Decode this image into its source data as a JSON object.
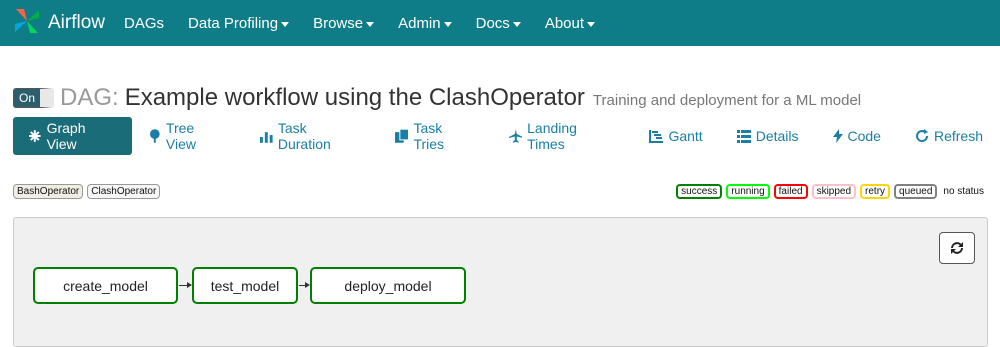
{
  "navbar": {
    "brand": "Airflow",
    "items": [
      {
        "label": "DAGs",
        "dropdown": false
      },
      {
        "label": "Data Profiling",
        "dropdown": true
      },
      {
        "label": "Browse",
        "dropdown": true
      },
      {
        "label": "Admin",
        "dropdown": true
      },
      {
        "label": "Docs",
        "dropdown": true
      },
      {
        "label": "About",
        "dropdown": true
      }
    ]
  },
  "dag": {
    "toggle": "On",
    "prefix": "DAG:",
    "name": "Example workflow using the ClashOperator",
    "description": "Training and deployment for a ML model"
  },
  "tabs": [
    {
      "label": "Graph View",
      "icon": "asterisk-icon",
      "active": true
    },
    {
      "label": "Tree View",
      "icon": "tree-icon",
      "active": false
    },
    {
      "label": "Task Duration",
      "icon": "bar-chart-icon",
      "active": false
    },
    {
      "label": "Task Tries",
      "icon": "duplicate-icon",
      "active": false
    },
    {
      "label": "Landing Times",
      "icon": "plane-icon",
      "active": false
    },
    {
      "label": "Gantt",
      "icon": "gantt-icon",
      "active": false
    },
    {
      "label": "Details",
      "icon": "list-icon",
      "active": false
    },
    {
      "label": "Code",
      "icon": "flash-icon",
      "active": false
    },
    {
      "label": "Refresh",
      "icon": "refresh-icon",
      "active": false
    }
  ],
  "operators": [
    "BashOperator",
    "ClashOperator"
  ],
  "legend": [
    {
      "label": "success",
      "color": "#008000"
    },
    {
      "label": "running",
      "color": "#00ff00"
    },
    {
      "label": "failed",
      "color": "#ff0000"
    },
    {
      "label": "skipped",
      "color": "#ffc0cb"
    },
    {
      "label": "retry",
      "color": "#ffd700"
    },
    {
      "label": "queued",
      "color": "#808080"
    }
  ],
  "legend_no_status": "no status",
  "graph": {
    "nodes": [
      "create_model",
      "test_model",
      "deploy_model"
    ],
    "node_status_color": "#008000"
  },
  "colors": {
    "navbar": "#0e7d87",
    "active_tab": "#196c78",
    "link": "#1a7fa6"
  }
}
